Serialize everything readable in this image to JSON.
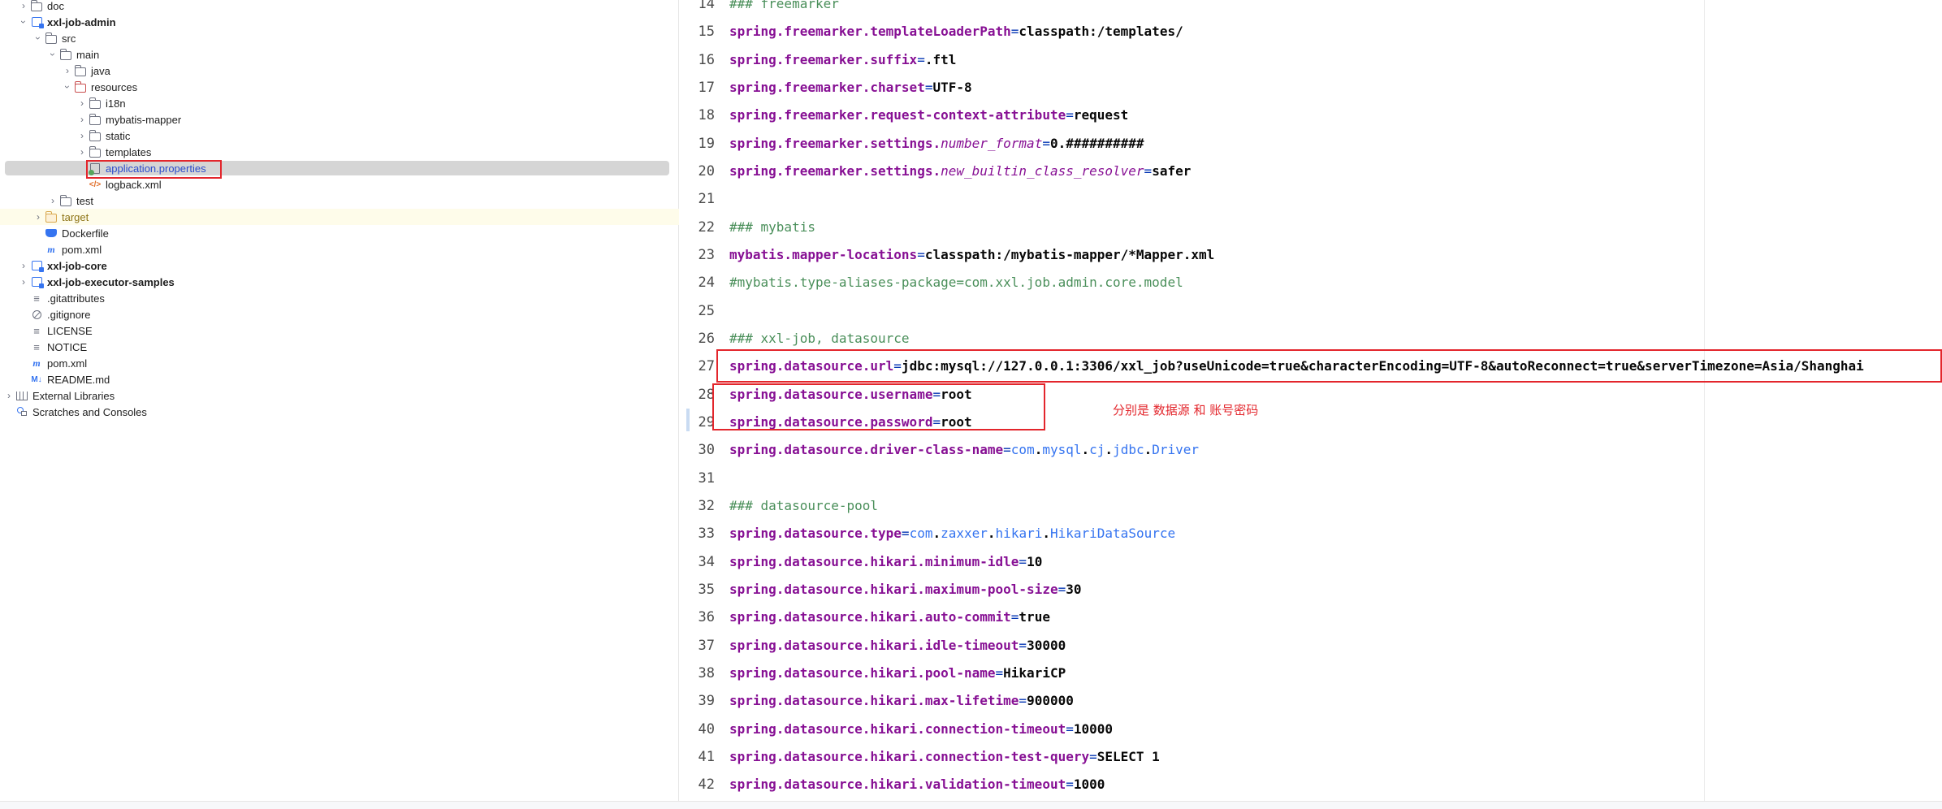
{
  "project_tree": [
    {
      "label": "doc",
      "level": 1,
      "arrow": "closed",
      "icon": "folder"
    },
    {
      "label": "xxl-job-admin",
      "level": 1,
      "arrow": "open",
      "icon": "module",
      "bold": true
    },
    {
      "label": "src",
      "level": 2,
      "arrow": "open",
      "icon": "folder"
    },
    {
      "label": "main",
      "level": 3,
      "arrow": "open",
      "icon": "folder"
    },
    {
      "label": "java",
      "level": 4,
      "arrow": "closed",
      "icon": "folder"
    },
    {
      "label": "resources",
      "level": 4,
      "arrow": "open",
      "icon": "resources-folder"
    },
    {
      "label": "i18n",
      "level": 5,
      "arrow": "closed",
      "icon": "folder"
    },
    {
      "label": "mybatis-mapper",
      "level": 5,
      "arrow": "closed",
      "icon": "folder"
    },
    {
      "label": "static",
      "level": 5,
      "arrow": "closed",
      "icon": "folder"
    },
    {
      "label": "templates",
      "level": 5,
      "arrow": "closed",
      "icon": "folder"
    },
    {
      "label": "application.properties",
      "level": 5,
      "arrow": "none",
      "icon": "properties-file",
      "selected": true
    },
    {
      "label": "logback.xml",
      "level": 5,
      "arrow": "none",
      "icon": "xml-file"
    },
    {
      "label": "test",
      "level": 3,
      "arrow": "closed",
      "icon": "folder"
    },
    {
      "label": "target",
      "level": 2,
      "arrow": "closed",
      "icon": "target-folder",
      "excluded": true
    },
    {
      "label": "Dockerfile",
      "level": 2,
      "arrow": "none",
      "icon": "docker-file"
    },
    {
      "label": "pom.xml",
      "level": 2,
      "arrow": "none",
      "icon": "maven-file"
    },
    {
      "label": "xxl-job-core",
      "level": 1,
      "arrow": "closed",
      "icon": "module",
      "bold": true
    },
    {
      "label": "xxl-job-executor-samples",
      "level": 1,
      "arrow": "closed",
      "icon": "module",
      "bold": true
    },
    {
      "label": ".gitattributes",
      "level": 1,
      "arrow": "none",
      "icon": "text-file"
    },
    {
      "label": ".gitignore",
      "level": 1,
      "arrow": "none",
      "icon": "ignore-file"
    },
    {
      "label": "LICENSE",
      "level": 1,
      "arrow": "none",
      "icon": "text-file"
    },
    {
      "label": "NOTICE",
      "level": 1,
      "arrow": "none",
      "icon": "text-file"
    },
    {
      "label": "pom.xml",
      "level": 1,
      "arrow": "none",
      "icon": "maven-file"
    },
    {
      "label": "README.md",
      "level": 1,
      "arrow": "none",
      "icon": "markdown-file"
    },
    {
      "label": "External Libraries",
      "level": 0,
      "arrow": "closed",
      "icon": "library"
    },
    {
      "label": "Scratches and Consoles",
      "level": 0,
      "arrow": "none",
      "icon": "scratches"
    }
  ],
  "editor": {
    "lines": [
      {
        "n": "14",
        "type": "comment",
        "text": "### freemarker"
      },
      {
        "n": "15",
        "type": "prop",
        "key": "spring.freemarker.templateLoaderPath",
        "value": "classpath:/templates/"
      },
      {
        "n": "16",
        "type": "prop",
        "key": "spring.freemarker.suffix",
        "value": ".ftl"
      },
      {
        "n": "17",
        "type": "prop",
        "key": "spring.freemarker.charset",
        "value": "UTF-8"
      },
      {
        "n": "18",
        "type": "prop",
        "key": "spring.freemarker.request-context-attribute",
        "value": "request"
      },
      {
        "n": "19",
        "type": "prop",
        "key": "spring.freemarker.settings.",
        "key_italic": "number_format",
        "value": "0.##########"
      },
      {
        "n": "20",
        "type": "prop",
        "key": "spring.freemarker.settings.",
        "key_italic": "new_builtin_class_resolver",
        "value": "safer"
      },
      {
        "n": "21",
        "type": "blank"
      },
      {
        "n": "22",
        "type": "comment",
        "text": "### mybatis"
      },
      {
        "n": "23",
        "type": "prop",
        "key": "mybatis.mapper-locations",
        "value": "classpath:/mybatis-mapper/*Mapper.xml"
      },
      {
        "n": "24",
        "type": "comment",
        "text": "#mybatis.type-aliases-package=com.xxl.job.admin.core.model"
      },
      {
        "n": "25",
        "type": "blank"
      },
      {
        "n": "26",
        "type": "comment",
        "text": "### xxl-job, datasource"
      },
      {
        "n": "27",
        "type": "prop",
        "key": "spring.datasource.url",
        "value": "jdbc:mysql://127.0.0.1:3306/xxl_job?useUnicode=true&characterEncoding=UTF-8&autoReconnect=true&serverTimezone=Asia/Shanghai"
      },
      {
        "n": "28",
        "type": "prop",
        "key": "spring.datasource.username",
        "value": "root"
      },
      {
        "n": "29",
        "type": "prop",
        "key": "spring.datasource.password",
        "value": "root"
      },
      {
        "n": "30",
        "type": "class",
        "key": "spring.datasource.driver-class-name",
        "value": "com.mysql.cj.jdbc.Driver"
      },
      {
        "n": "31",
        "type": "blank"
      },
      {
        "n": "32",
        "type": "comment",
        "text": "### datasource-pool"
      },
      {
        "n": "33",
        "type": "class",
        "key": "spring.datasource.type",
        "value": "com.zaxxer.hikari.HikariDataSource"
      },
      {
        "n": "34",
        "type": "prop",
        "key": "spring.datasource.hikari.minimum-idle",
        "value": "10"
      },
      {
        "n": "35",
        "type": "prop",
        "key": "spring.datasource.hikari.maximum-pool-size",
        "value": "30"
      },
      {
        "n": "36",
        "type": "prop",
        "key": "spring.datasource.hikari.auto-commit",
        "value": "true"
      },
      {
        "n": "37",
        "type": "prop",
        "key": "spring.datasource.hikari.idle-timeout",
        "value": "30000"
      },
      {
        "n": "38",
        "type": "prop",
        "key": "spring.datasource.hikari.pool-name",
        "value": "HikariCP"
      },
      {
        "n": "39",
        "type": "prop",
        "key": "spring.datasource.hikari.max-lifetime",
        "value": "900000"
      },
      {
        "n": "40",
        "type": "prop",
        "key": "spring.datasource.hikari.connection-timeout",
        "value": "10000"
      },
      {
        "n": "41",
        "type": "prop",
        "key": "spring.datasource.hikari.connection-test-query",
        "value": "SELECT 1"
      },
      {
        "n": "42",
        "type": "prop",
        "key": "spring.datasource.hikari.validation-timeout",
        "value": "1000"
      }
    ],
    "annotation_note": "分别是 数据源 和 账号密码"
  },
  "colors": {
    "key": "#871094",
    "value": "#080808",
    "operator": "#0033b3",
    "comment": "#4a8f5a",
    "class_ref": "#3574f0",
    "annotation": "#e3262c",
    "selection": "#d5d5d5"
  }
}
